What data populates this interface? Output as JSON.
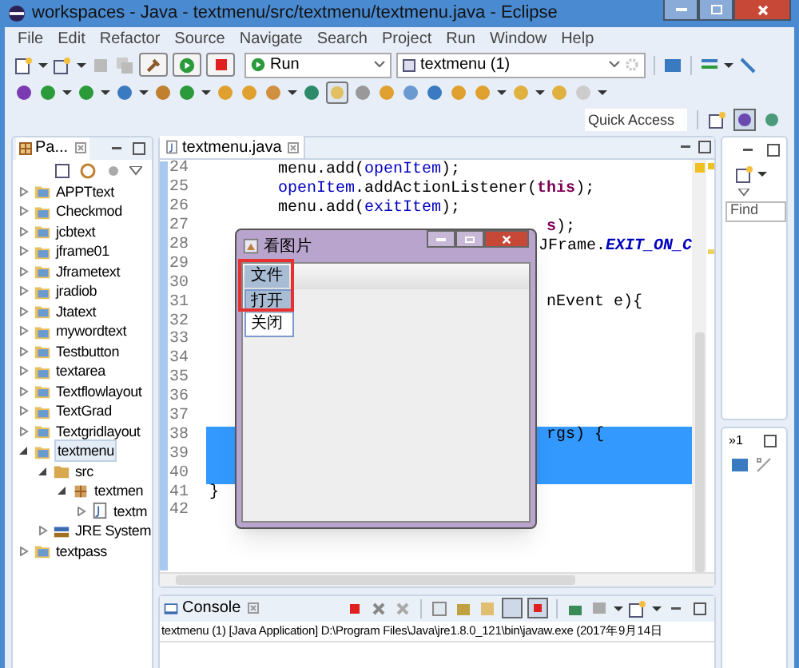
{
  "window": {
    "title": "workspaces - Java - textmenu/src/textmenu/textmenu.java - Eclipse"
  },
  "menu_bar": [
    "File",
    "Edit",
    "Refactor",
    "Source",
    "Navigate",
    "Search",
    "Project",
    "Run",
    "Window",
    "Help"
  ],
  "toolbar": {
    "run_mode": "Run",
    "launch_config": "textmenu (1)",
    "quick_access": {
      "placeholder": "Quick Access"
    }
  },
  "package_explorer": {
    "tab": "Pa...",
    "tree": [
      {
        "label": "APPTtext",
        "kind": "project",
        "expanded": false,
        "selected": false
      },
      {
        "label": "Checkmod",
        "kind": "project",
        "expanded": false,
        "selected": false
      },
      {
        "label": "jcbtext",
        "kind": "project",
        "expanded": false,
        "selected": false
      },
      {
        "label": "jframe01",
        "kind": "project",
        "expanded": false,
        "selected": false
      },
      {
        "label": "Jframetext",
        "kind": "project",
        "expanded": false,
        "selected": false
      },
      {
        "label": "jradiob",
        "kind": "project",
        "expanded": false,
        "selected": false
      },
      {
        "label": "Jtatext",
        "kind": "project",
        "expanded": false,
        "selected": false
      },
      {
        "label": "mywordtext",
        "kind": "project",
        "expanded": false,
        "selected": false
      },
      {
        "label": "Testbutton",
        "kind": "project",
        "expanded": false,
        "selected": false
      },
      {
        "label": "textarea",
        "kind": "project",
        "expanded": false,
        "selected": false
      },
      {
        "label": "Textflowlayout",
        "kind": "project",
        "expanded": false,
        "selected": false
      },
      {
        "label": "TextGrad",
        "kind": "project",
        "expanded": false,
        "selected": false
      },
      {
        "label": "Textgridlayout",
        "kind": "project",
        "expanded": false,
        "selected": false
      },
      {
        "label": "textmenu",
        "kind": "project",
        "expanded": true,
        "selected": true,
        "children": [
          {
            "label": "src",
            "kind": "source",
            "expanded": true,
            "selected": false,
            "children": [
              {
                "label": "textmen",
                "kind": "package",
                "expanded": true,
                "selected": false,
                "children": [
                  {
                    "label": "textm",
                    "kind": "file",
                    "expanded": false,
                    "selected": false
                  }
                ]
              }
            ]
          },
          {
            "label": "JRE System",
            "kind": "library",
            "expanded": false,
            "selected": false
          }
        ]
      },
      {
        "label": "textpass",
        "kind": "project",
        "expanded": false,
        "selected": false
      }
    ]
  },
  "editor": {
    "tab": "textmenu.java",
    "lines": [
      {
        "number": "24",
        "kind": "code",
        "highlighted": false,
        "tokens": [
          {
            "text": "menu.add(",
            "kind": "plain"
          },
          {
            "text": "openItem",
            "kind": "field"
          },
          {
            "text": ");",
            "kind": "plain"
          }
        ]
      },
      {
        "number": "25",
        "kind": "code",
        "highlighted": false,
        "tokens": [
          {
            "text": "openItem",
            "kind": "field"
          },
          {
            "text": ".addActionListener(",
            "kind": "plain"
          },
          {
            "text": "this",
            "kind": "keyword"
          },
          {
            "text": ");",
            "kind": "plain"
          }
        ]
      },
      {
        "number": "26",
        "kind": "code",
        "highlighted": false,
        "tokens": [
          {
            "text": "menu.add(",
            "kind": "plain"
          },
          {
            "text": "exitItem",
            "kind": "field"
          },
          {
            "text": ");",
            "kind": "plain"
          }
        ]
      },
      {
        "number": "27",
        "kind": "tail",
        "highlighted": false,
        "tokens": [
          {
            "text": "s",
            "kind": "keyword"
          },
          {
            "text": ");",
            "kind": "plain"
          }
        ]
      },
      {
        "number": "28",
        "kind": "tail",
        "highlighted": false,
        "tokens": [
          {
            "text": "JFrame.",
            "kind": "plain"
          },
          {
            "text": "EXIT_ON_C",
            "kind": "constant"
          }
        ]
      },
      {
        "number": "29",
        "highlighted": false
      },
      {
        "number": "30",
        "highlighted": false
      },
      {
        "number": "31",
        "kind": "tail",
        "highlighted": false,
        "tokens": [
          {
            "text": "nEvent e){",
            "kind": "plain"
          }
        ]
      },
      {
        "number": "32",
        "highlighted": false
      },
      {
        "number": "33",
        "highlighted": false
      },
      {
        "number": "34",
        "highlighted": false
      },
      {
        "number": "35",
        "highlighted": false
      },
      {
        "number": "36",
        "highlighted": false
      },
      {
        "number": "37",
        "highlighted": false
      },
      {
        "number": "38",
        "kind": "tail",
        "highlighted": true,
        "tokens": [
          {
            "text": "rgs) {",
            "kind": "plain"
          }
        ]
      },
      {
        "number": "39",
        "highlighted": true
      },
      {
        "number": "40",
        "highlighted": true
      },
      {
        "number": "41",
        "kind": "top",
        "highlighted": false,
        "tokens": [
          {
            "text": "}",
            "kind": "plain"
          }
        ]
      },
      {
        "number": "42",
        "highlighted": false
      }
    ]
  },
  "swing_window": {
    "title": "看图片",
    "menus": [
      {
        "label": "文件",
        "selected": true,
        "items": [
          {
            "label": "打开",
            "selected": true
          },
          {
            "label": "关闭",
            "selected": false
          }
        ]
      }
    ]
  },
  "console": {
    "tab": "Console",
    "text": "textmenu (1) [Java Application] D:\\Program Files\\Java\\jre1.8.0_121\\bin\\javaw.exe (2017年9月14日"
  },
  "outline": {
    "find": {
      "placeholder": "Find"
    },
    "tab": "»1"
  }
}
